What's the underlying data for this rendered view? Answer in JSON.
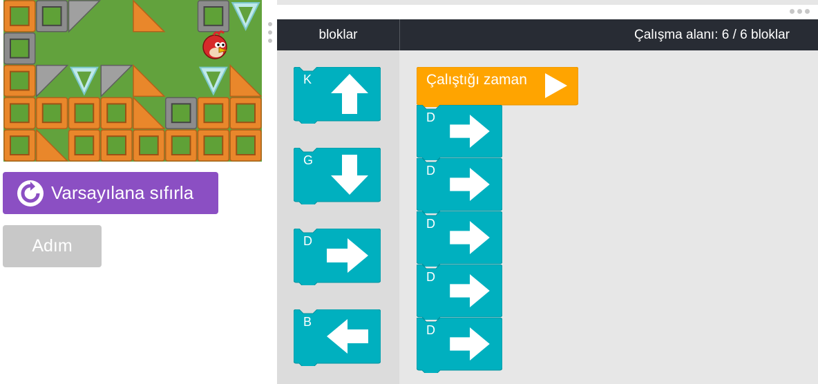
{
  "left_panel": {
    "reset_button_label": "Varsayılana sıfırla",
    "step_button_label": "Adım",
    "reset_icon": "refresh-icon"
  },
  "header": {
    "toolbox_title": "bloklar",
    "workspace_title": "Çalışma alanı: 6 / 6 bloklar"
  },
  "toolbox": {
    "blocks": [
      {
        "letter": "K",
        "icon": "arrow-up-icon"
      },
      {
        "letter": "G",
        "icon": "arrow-down-icon"
      },
      {
        "letter": "D",
        "icon": "arrow-right-icon"
      },
      {
        "letter": "B",
        "icon": "arrow-left-icon"
      }
    ]
  },
  "workspace": {
    "run_block_label": "Çalıştığı zaman",
    "run_icon": "play-icon",
    "program": [
      {
        "letter": "D",
        "icon": "arrow-right-icon"
      },
      {
        "letter": "D",
        "icon": "arrow-right-icon"
      },
      {
        "letter": "D",
        "icon": "arrow-right-icon"
      },
      {
        "letter": "D",
        "icon": "arrow-right-icon"
      },
      {
        "letter": "D",
        "icon": "arrow-right-icon"
      }
    ]
  },
  "colors": {
    "block_teal": "#00b0bf",
    "block_teal_dark": "#00939f",
    "run_orange": "#ffa400",
    "reset_purple": "#8b4fc3",
    "step_gray": "#c8c8c8",
    "header_dark": "#282c34"
  }
}
